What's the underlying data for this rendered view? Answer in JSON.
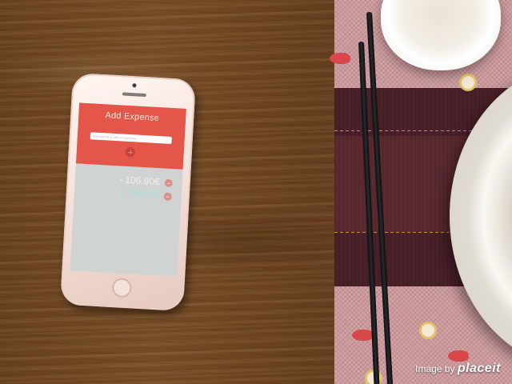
{
  "app": {
    "header_title": "Add Expense",
    "input_placeholder": "Start typing to add an expense...",
    "accent_color": "#e4564a",
    "add_icon": "plus-circle-icon",
    "delete_icon": "minus-circle-icon"
  },
  "expenses": [
    {
      "amount": "- 106.90€"
    },
    {
      "amount": "+ 136.60€"
    }
  ],
  "credit": {
    "prefix": "Image by",
    "brand": "placeit"
  }
}
